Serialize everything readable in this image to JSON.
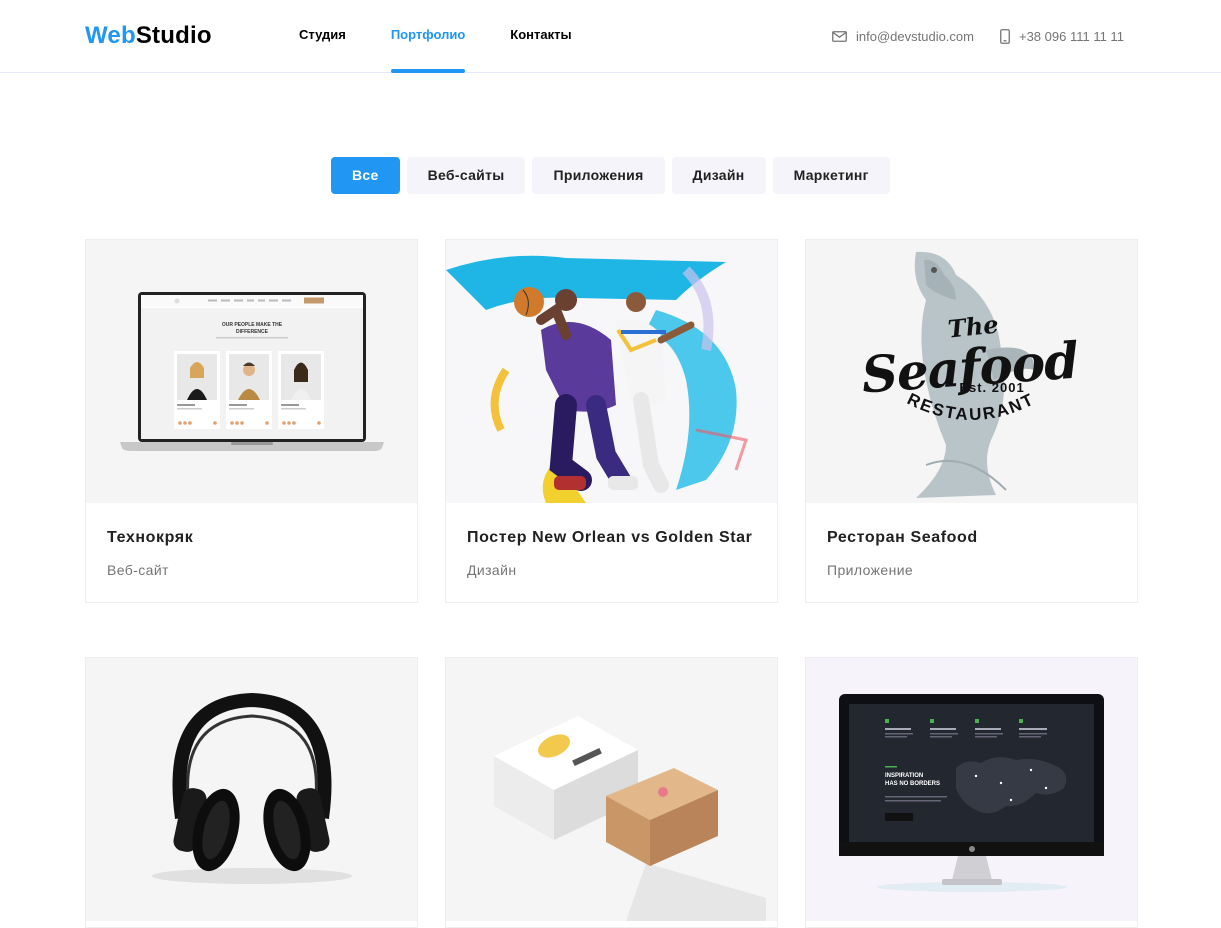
{
  "header": {
    "logo_part1": "Web",
    "logo_part2": "Studio",
    "nav": [
      {
        "label": "Студия",
        "active": false
      },
      {
        "label": "Портфолио",
        "active": true
      },
      {
        "label": "Контакты",
        "active": false
      }
    ],
    "email": "info@devstudio.com",
    "phone": "+38 096 111 11 11",
    "email_icon": "mail-icon",
    "phone_icon": "phone-icon"
  },
  "filters": [
    {
      "label": "Все",
      "active": true
    },
    {
      "label": "Веб-сайты",
      "active": false
    },
    {
      "label": "Приложения",
      "active": false
    },
    {
      "label": "Дизайн",
      "active": false
    },
    {
      "label": "Маркетинг",
      "active": false
    }
  ],
  "cards": [
    {
      "title": "Технокряк",
      "category": "Веб-сайт"
    },
    {
      "title": "Постер New Orlean vs Golden Star",
      "category": "Дизайн"
    },
    {
      "title": "Ресторан Seafood",
      "category": "Приложение"
    },
    {
      "title": "",
      "category": ""
    },
    {
      "title": "",
      "category": ""
    },
    {
      "title": "",
      "category": ""
    }
  ],
  "artwork": {
    "laptop_heading": "OUR PEOPLE MAKE THE DIFFERENCE",
    "seafood_the": "The",
    "seafood_name": "Seafood",
    "seafood_est": "Est. 2001",
    "seafood_restaurant": "RESTAURANT",
    "monitor_heading_1": "INSPIRATION",
    "monitor_heading_2": "HAS NO BORDERS"
  },
  "colors": {
    "accent": "#2196f3",
    "text": "#212121",
    "muted": "#757575",
    "filter_bg": "#f5f4fa"
  }
}
